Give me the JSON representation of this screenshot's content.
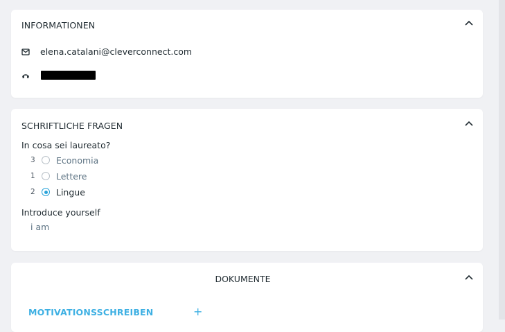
{
  "informationen": {
    "title": "INFORMATIONEN",
    "email": "elena.catalani@cleverconnect.com",
    "icons": {
      "email": "mail-icon",
      "phone": "phone-icon",
      "collapse": "chevron-up-icon"
    }
  },
  "schriftliche_fragen": {
    "title": "SCHRIFTLICHE FRAGEN",
    "questions": [
      {
        "label": "In cosa sei laureato?",
        "options": [
          {
            "count": "3",
            "label": "Economia",
            "selected": false
          },
          {
            "count": "1",
            "label": "Lettere",
            "selected": false
          },
          {
            "count": "2",
            "label": "Lingue",
            "selected": true
          }
        ]
      },
      {
        "label": "Introduce yourself",
        "answer": "i am"
      }
    ]
  },
  "dokumente": {
    "title": "DOKUMENTE",
    "items": [
      {
        "label": "MOTIVATIONSSCHREIBEN",
        "action": "+"
      }
    ]
  },
  "colors": {
    "accent": "#3eb0e3",
    "background": "#f0f1f4",
    "card": "#ffffff",
    "text": "#1f2a30",
    "muted": "#5d7383"
  }
}
